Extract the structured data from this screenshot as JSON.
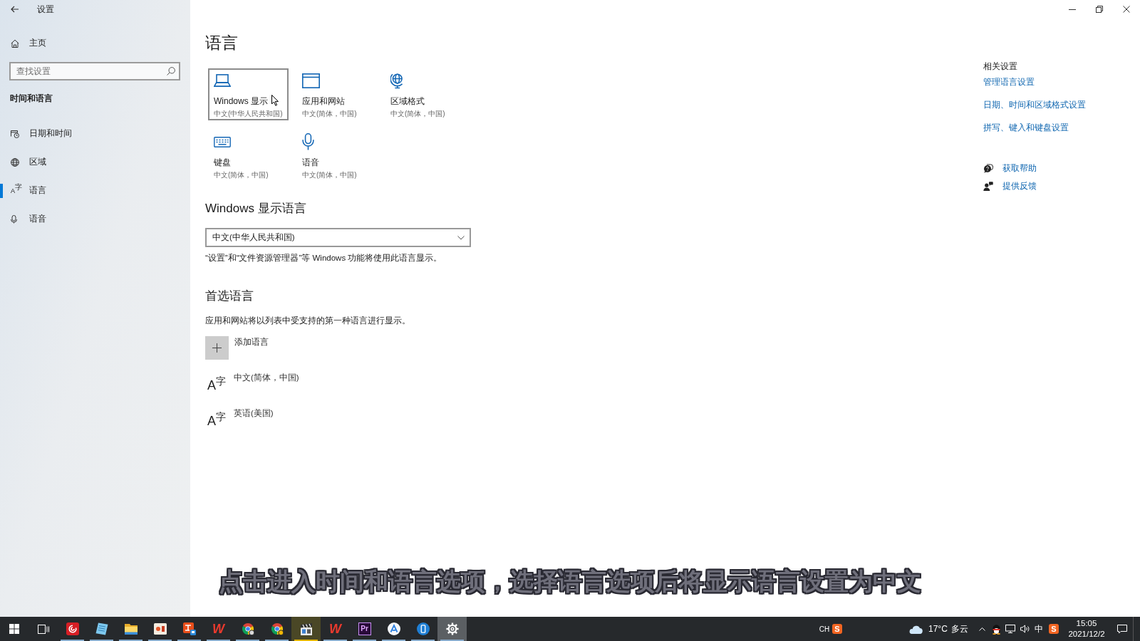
{
  "window": {
    "title": "设置"
  },
  "sidebar": {
    "home": "主页",
    "search": {
      "placeholder": "查找设置"
    },
    "section": "时间和语言",
    "items": [
      {
        "kind": "datetime",
        "label": "日期和时间",
        "selected": false
      },
      {
        "kind": "region",
        "label": "区域",
        "selected": false
      },
      {
        "kind": "language",
        "glyph": "A$^{字}$",
        "label": "语言",
        "selected": true
      },
      {
        "kind": "speech",
        "label": "语音",
        "selected": false
      }
    ]
  },
  "page": {
    "title": "语言",
    "tiles": [
      {
        "kind": "display",
        "label": "Windows 显示",
        "value": "中文(中华人民共和国)",
        "selected": true
      },
      {
        "kind": "apps",
        "label": "应用和网站",
        "value": "中文(简体，中国)",
        "selected": false
      },
      {
        "kind": "region",
        "label": "区域格式",
        "value": "中文(简体，中国)",
        "selected": false
      },
      {
        "kind": "keyboard",
        "label": "键盘",
        "value": "中文(简体，中国)",
        "selected": false
      },
      {
        "kind": "speech",
        "label": "语音",
        "value": "中文(简体，中国)",
        "selected": false
      }
    ],
    "display_language": {
      "heading": "Windows 显示语言",
      "dropdown": {
        "value": "中文(中华人民共和国)"
      },
      "description": "“设置”和“文件资源管理器”等 Windows 功能将使用此语言显示。"
    },
    "preferred_languages": {
      "heading": "首选语言",
      "description": "应用和网站将以列表中受支持的第一种语言进行显示。",
      "add_button": "添加语言",
      "languages": [
        {
          "glyph": "A$^{字}$",
          "name": "中文(简体，中国)"
        },
        {
          "glyph": "A$^{字}$",
          "name": "英语(美国)"
        }
      ]
    }
  },
  "related_settings": {
    "heading": "相关设置",
    "links": [
      "管理语言设置",
      "日期、时间和区域格式设置",
      "拼写、键入和键盘设置"
    ],
    "support": [
      {
        "kind": "help",
        "label": "获取帮助"
      },
      {
        "kind": "feedback",
        "label": "提供反馈"
      }
    ]
  },
  "subtitle": "点击进入时间和语言选项，选择语言选项后将显示语言设置为中文",
  "taskbar": {
    "apps": [
      {
        "kind": "music",
        "running": true,
        "attention": false,
        "selected": false
      },
      {
        "kind": "notepad",
        "running": true,
        "attention": false,
        "selected": false
      },
      {
        "kind": "folder",
        "running": true,
        "attention": false,
        "selected": false
      },
      {
        "kind": "slides",
        "running": true,
        "attention": false,
        "selected": false
      },
      {
        "kind": "office",
        "running": true,
        "attention": false,
        "selected": false
      },
      {
        "kind": "wps",
        "label": "W",
        "running": true,
        "attention": false,
        "selected": false
      },
      {
        "kind": "browser",
        "running": true,
        "attention": false,
        "selected": false
      },
      {
        "kind": "browser_alt",
        "running": true,
        "attention": false,
        "selected": false
      },
      {
        "kind": "clapper",
        "running": true,
        "attention": true,
        "selected": false
      },
      {
        "kind": "wps",
        "label": "W",
        "running": true,
        "attention": false,
        "selected": false
      },
      {
        "kind": "pr",
        "label": "Pr",
        "running": true,
        "attention": false,
        "selected": false
      },
      {
        "kind": "peak",
        "running": true,
        "attention": false,
        "selected": false
      },
      {
        "kind": "phone",
        "running": true,
        "attention": false,
        "selected": false
      },
      {
        "kind": "settings",
        "running": true,
        "attention": false,
        "selected": true
      }
    ],
    "tray": {
      "input_language": "CH",
      "language_bar_logo": "S",
      "weather": {
        "temperature": "17°C",
        "condition": "多云"
      },
      "ime_mode": "中",
      "tray_logo": "S",
      "time": "15:05",
      "date": "2021/12/2"
    }
  }
}
